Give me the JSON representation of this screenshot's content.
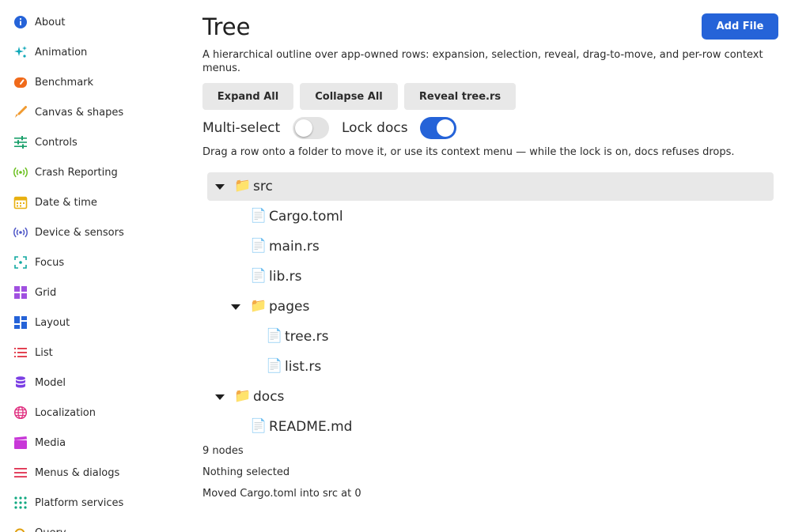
{
  "sidebar": {
    "items": [
      {
        "label": "About",
        "icon": "info-icon",
        "color": "#2563d8"
      },
      {
        "label": "Animation",
        "icon": "sparkle-icon",
        "color": "#10a8b8"
      },
      {
        "label": "Benchmark",
        "icon": "speedometer-icon",
        "color": "#f06a1a"
      },
      {
        "label": "Canvas & shapes",
        "icon": "brush-icon",
        "color": "#f09a30"
      },
      {
        "label": "Controls",
        "icon": "sliders-icon",
        "color": "#1aa06a"
      },
      {
        "label": "Crash Reporting",
        "icon": "broadcast-icon",
        "color": "#6cc020"
      },
      {
        "label": "Date & time",
        "icon": "calendar-icon",
        "color": "#e8b010"
      },
      {
        "label": "Device & sensors",
        "icon": "sensor-icon",
        "color": "#5058c8"
      },
      {
        "label": "Focus",
        "icon": "focus-icon",
        "color": "#10a8a0"
      },
      {
        "label": "Grid",
        "icon": "grid-icon",
        "color": "#a050e0"
      },
      {
        "label": "Layout",
        "icon": "layout-icon",
        "color": "#2563d8"
      },
      {
        "label": "List",
        "icon": "list-icon",
        "color": "#e03040"
      },
      {
        "label": "Model",
        "icon": "database-icon",
        "color": "#7b3fe4"
      },
      {
        "label": "Localization",
        "icon": "globe-icon",
        "color": "#e03080"
      },
      {
        "label": "Media",
        "icon": "clapper-icon",
        "color": "#c838d8"
      },
      {
        "label": "Menus & dialogs",
        "icon": "menu-icon",
        "color": "#e03050"
      },
      {
        "label": "Platform services",
        "icon": "dots-grid-icon",
        "color": "#10a880"
      },
      {
        "label": "Query",
        "icon": "query-icon",
        "color": "#e0a010"
      }
    ]
  },
  "page": {
    "title": "Tree",
    "add_file_label": "Add File",
    "description": "A hierarchical outline over app-owned rows: expansion, selection, reveal, drag-to-move, and per-row context menus.",
    "buttons": {
      "expand_all": "Expand All",
      "collapse_all": "Collapse All",
      "reveal": "Reveal tree.rs"
    },
    "toggles": {
      "multi_select": {
        "label": "Multi-select",
        "on": false
      },
      "lock_docs": {
        "label": "Lock docs",
        "on": true
      }
    },
    "hint": "Drag a row onto a folder to move it, or use its context menu — while the lock is on, docs refuses drops."
  },
  "tree": {
    "nodes": [
      {
        "label": "src",
        "type": "folder",
        "depth": 0,
        "expanded": true,
        "selected": true
      },
      {
        "label": "Cargo.toml",
        "type": "file",
        "depth": 1
      },
      {
        "label": "main.rs",
        "type": "file",
        "depth": 1
      },
      {
        "label": "lib.rs",
        "type": "file",
        "depth": 1
      },
      {
        "label": "pages",
        "type": "folder",
        "depth": 1,
        "expanded": true
      },
      {
        "label": "tree.rs",
        "type": "file",
        "depth": 2
      },
      {
        "label": "list.rs",
        "type": "file",
        "depth": 2
      },
      {
        "label": "docs",
        "type": "folder",
        "depth": 0,
        "expanded": true
      },
      {
        "label": "README.md",
        "type": "file",
        "depth": 1
      }
    ],
    "folder_glyph": "📁",
    "file_glyph": "📄"
  },
  "status": {
    "count": "9 nodes",
    "selection": "Nothing selected",
    "last_action": "Moved Cargo.toml into src at 0"
  },
  "colors": {
    "accent": "#2563d8",
    "button_bg": "#e8e8e8",
    "selected_row": "#e8e8e8"
  }
}
